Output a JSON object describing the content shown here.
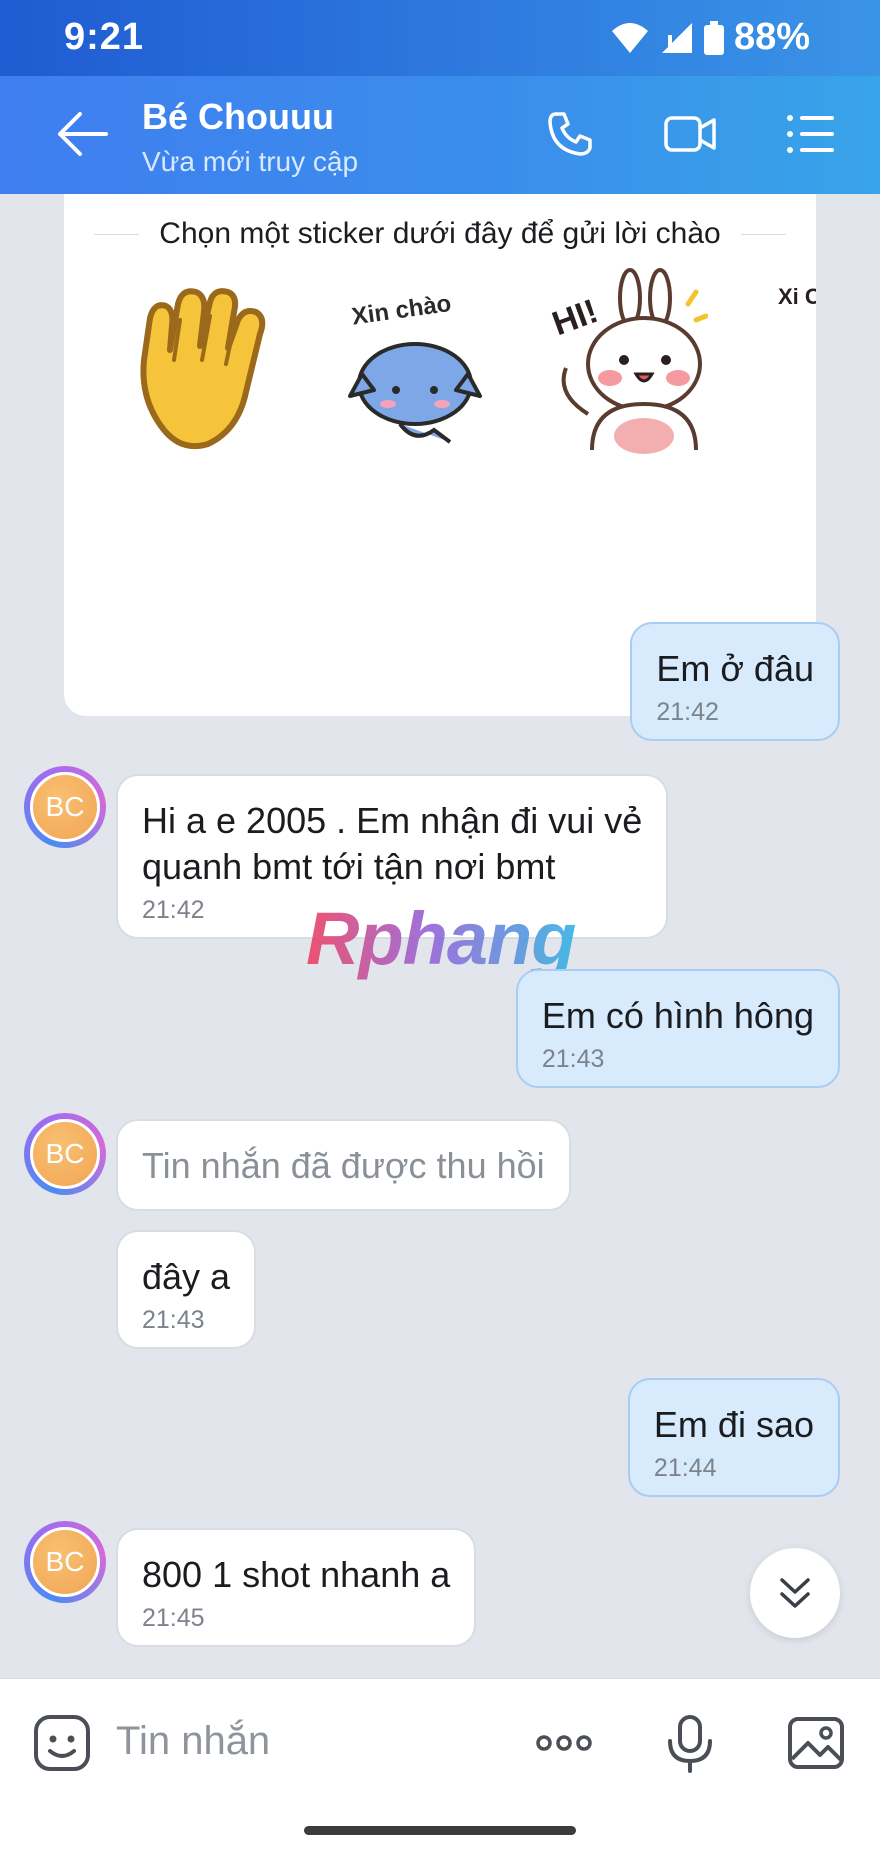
{
  "status_bar": {
    "time": "9:21",
    "battery": "88%"
  },
  "header": {
    "name": "Bé Chouuu",
    "status": "Vừa mới truy cập"
  },
  "sticker_card": {
    "hint": "Chọn một sticker dưới đây để gửi lời chào",
    "sticker_text": {
      "cat": "Xin chào",
      "bunny": "HI!",
      "partial": "Xi Ch"
    }
  },
  "messages": [
    {
      "dir": "out",
      "text": "Em ở đâu",
      "time": "21:42"
    },
    {
      "dir": "in",
      "avatar": "BC",
      "line1": "Hi a e 2005 . Em nhận đi vui vẻ",
      "line2": "quanh bmt tới tận nơi bmt",
      "time": "21:42"
    },
    {
      "dir": "out",
      "text": "Em có hình hông",
      "time": "21:43"
    },
    {
      "dir": "in",
      "avatar": "BC",
      "text": "Tin nhắn đã được thu hồi",
      "recalled": true
    },
    {
      "dir": "in",
      "text": "đây a",
      "time": "21:43"
    },
    {
      "dir": "out",
      "text": "Em đi sao",
      "time": "21:44"
    },
    {
      "dir": "in",
      "avatar": "BC",
      "text": "800 1 shot nhanh a",
      "time": "21:45"
    }
  ],
  "watermark": "Rphang",
  "input": {
    "placeholder": "Tin nhắn"
  },
  "colors": {
    "header": "#3a8deb",
    "out_bubble": "#d7ebfd",
    "in_bubble": "#ffffff",
    "background": "#e2e6ec"
  }
}
